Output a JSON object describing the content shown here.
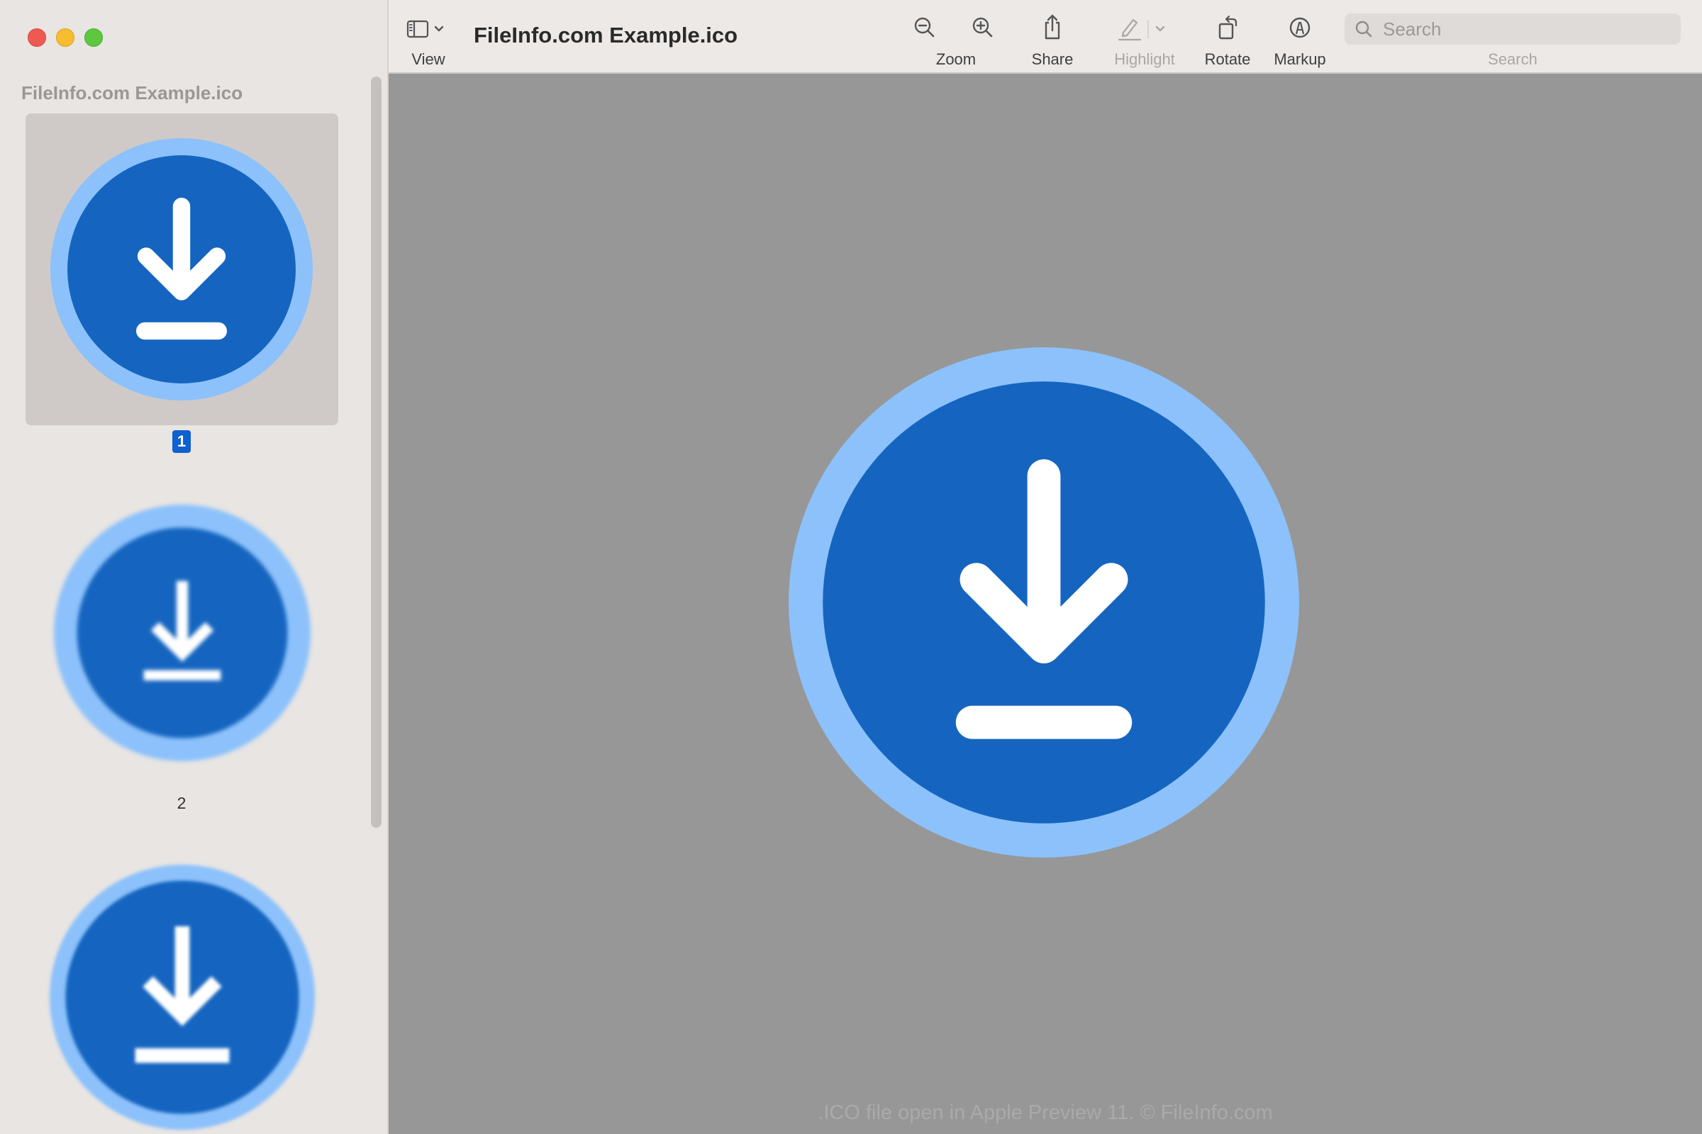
{
  "window": {
    "controls": [
      "close",
      "minimize",
      "zoom"
    ]
  },
  "sidebar": {
    "title": "FileInfo.com Example.ico",
    "pages": [
      {
        "label": "1",
        "selected": true
      },
      {
        "label": "2",
        "selected": false
      },
      {
        "label": "",
        "selected": false
      }
    ]
  },
  "toolbar": {
    "view_label": "View",
    "document_title": "FileInfo.com Example.ico",
    "zoom_label": "Zoom",
    "share_label": "Share",
    "highlight_label": "Highlight",
    "rotate_label": "Rotate",
    "markup_label": "Markup",
    "search_label": "Search",
    "search_placeholder": "Search"
  },
  "main": {
    "caption": ".ICO file open in Apple Preview 11. © FileInfo.com"
  },
  "colors": {
    "icon_ring": "#8cc1fb",
    "icon_fill": "#1565c0",
    "canvas": "#979797",
    "selection": "#0d60d0"
  },
  "icons": [
    "sidebar-toggle-icon",
    "chevron-down-icon",
    "zoom-out-icon",
    "zoom-in-icon",
    "share-icon",
    "highlight-pen-icon",
    "rotate-icon",
    "markup-icon",
    "search-icon",
    "download-icon"
  ]
}
